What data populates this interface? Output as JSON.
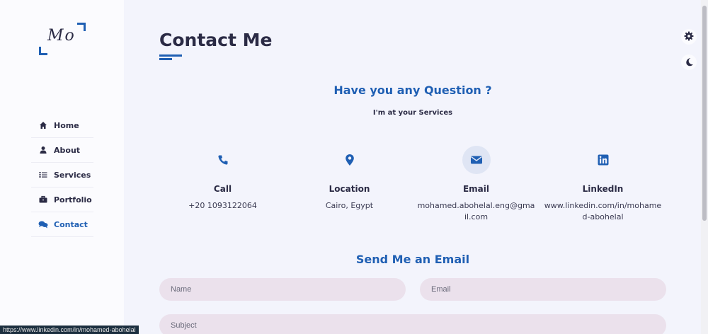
{
  "logo": {
    "text": "Mo"
  },
  "nav": {
    "items": [
      {
        "label": "Home",
        "icon": "home-icon"
      },
      {
        "label": "About",
        "icon": "user-icon"
      },
      {
        "label": "Services",
        "icon": "list-icon"
      },
      {
        "label": "Portfolio",
        "icon": "briefcase-icon"
      },
      {
        "label": "Contact",
        "icon": "comments-icon",
        "active": true
      }
    ]
  },
  "main": {
    "title": "Contact Me",
    "question": "Have you any Question ?",
    "subtitle": "I'm at your Services",
    "cards": [
      {
        "label": "Call",
        "value": "+20 1093122064",
        "icon": "phone-icon"
      },
      {
        "label": "Location",
        "value": "Cairo, Egypt",
        "icon": "location-pin-icon"
      },
      {
        "label": "Email",
        "value": "mohamed.abohelal.eng@gmail.com",
        "icon": "envelope-icon"
      },
      {
        "label": "LinkedIn",
        "value": "www.linkedin.com/in/mohamed-abohelal",
        "icon": "linkedin-icon"
      }
    ],
    "send_title": "Send Me an Email",
    "form": {
      "name_placeholder": "Name",
      "email_placeholder": "Email",
      "subject_placeholder": "Subject"
    }
  },
  "status_bar": {
    "url": "https://www.linkedin.com/in/mohamed-abohelal"
  },
  "colors": {
    "accent": "#1f5fb3",
    "text": "#2b2b45",
    "background": "#f3f4fc",
    "input_bg": "#ebe1ec"
  }
}
